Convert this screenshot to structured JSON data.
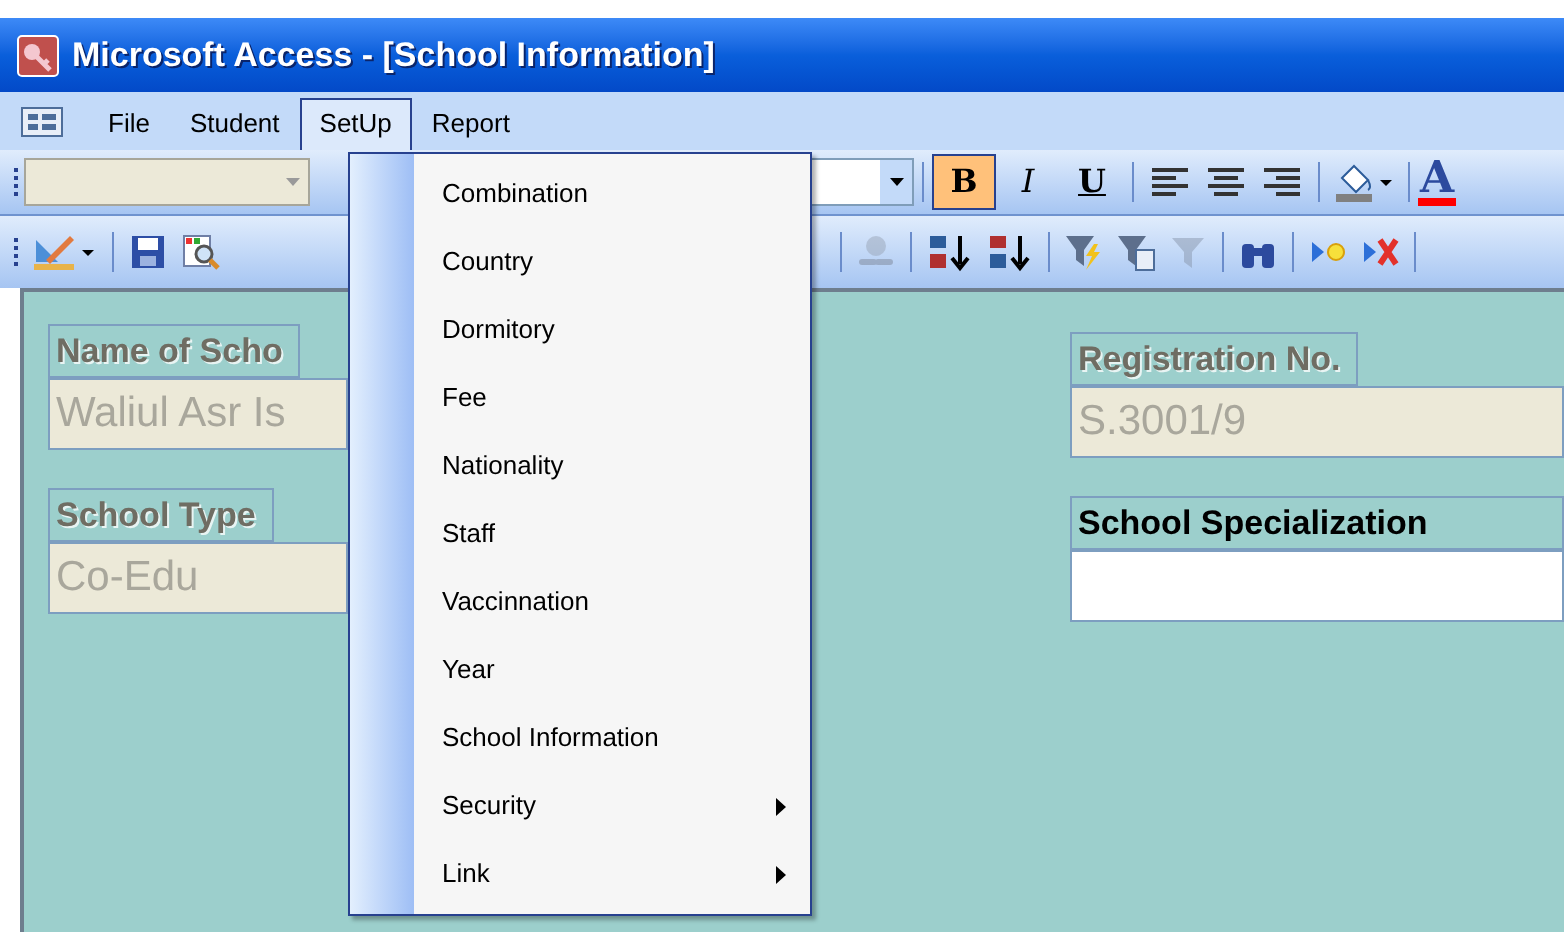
{
  "window": {
    "title": "Microsoft Access - [School Information]"
  },
  "menu_bar": [
    {
      "label": "File",
      "selected": false
    },
    {
      "label": "Student",
      "selected": false
    },
    {
      "label": "SetUp",
      "selected": true
    },
    {
      "label": "Report",
      "selected": false
    }
  ],
  "formatting_toolbar": {
    "format_buttons": [
      {
        "label": "B",
        "selected": true
      },
      {
        "label": "I",
        "selected": false
      },
      {
        "label": "U",
        "selected": false
      }
    ],
    "font_color_label": "A"
  },
  "form": {
    "left_fields": [
      {
        "label": "Name of Scho",
        "value": "Waliul Asr Is",
        "disabled": true
      },
      {
        "label": "School Type",
        "value": "Co-Edu",
        "disabled": true
      }
    ],
    "right_fields": [
      {
        "label": "Registration No.",
        "value": "S.3001/9",
        "disabled": true
      },
      {
        "label": "School Specialization",
        "disabled": false
      }
    ]
  },
  "setup_menu": [
    {
      "label": "Combination",
      "kind": "item"
    },
    {
      "label": "Country",
      "kind": "item"
    },
    {
      "label": "Dormitory",
      "kind": "item"
    },
    {
      "label": "Fee",
      "kind": "item"
    },
    {
      "label": "Nationality",
      "kind": "item"
    },
    {
      "label": "Staff",
      "kind": "item"
    },
    {
      "label": "Vaccinnation",
      "kind": "item"
    },
    {
      "label": "Year",
      "kind": "item"
    },
    {
      "label": "School Information",
      "kind": "item"
    },
    {
      "label": "Security",
      "kind": "submenu"
    },
    {
      "label": "Link",
      "kind": "submenu"
    }
  ]
}
